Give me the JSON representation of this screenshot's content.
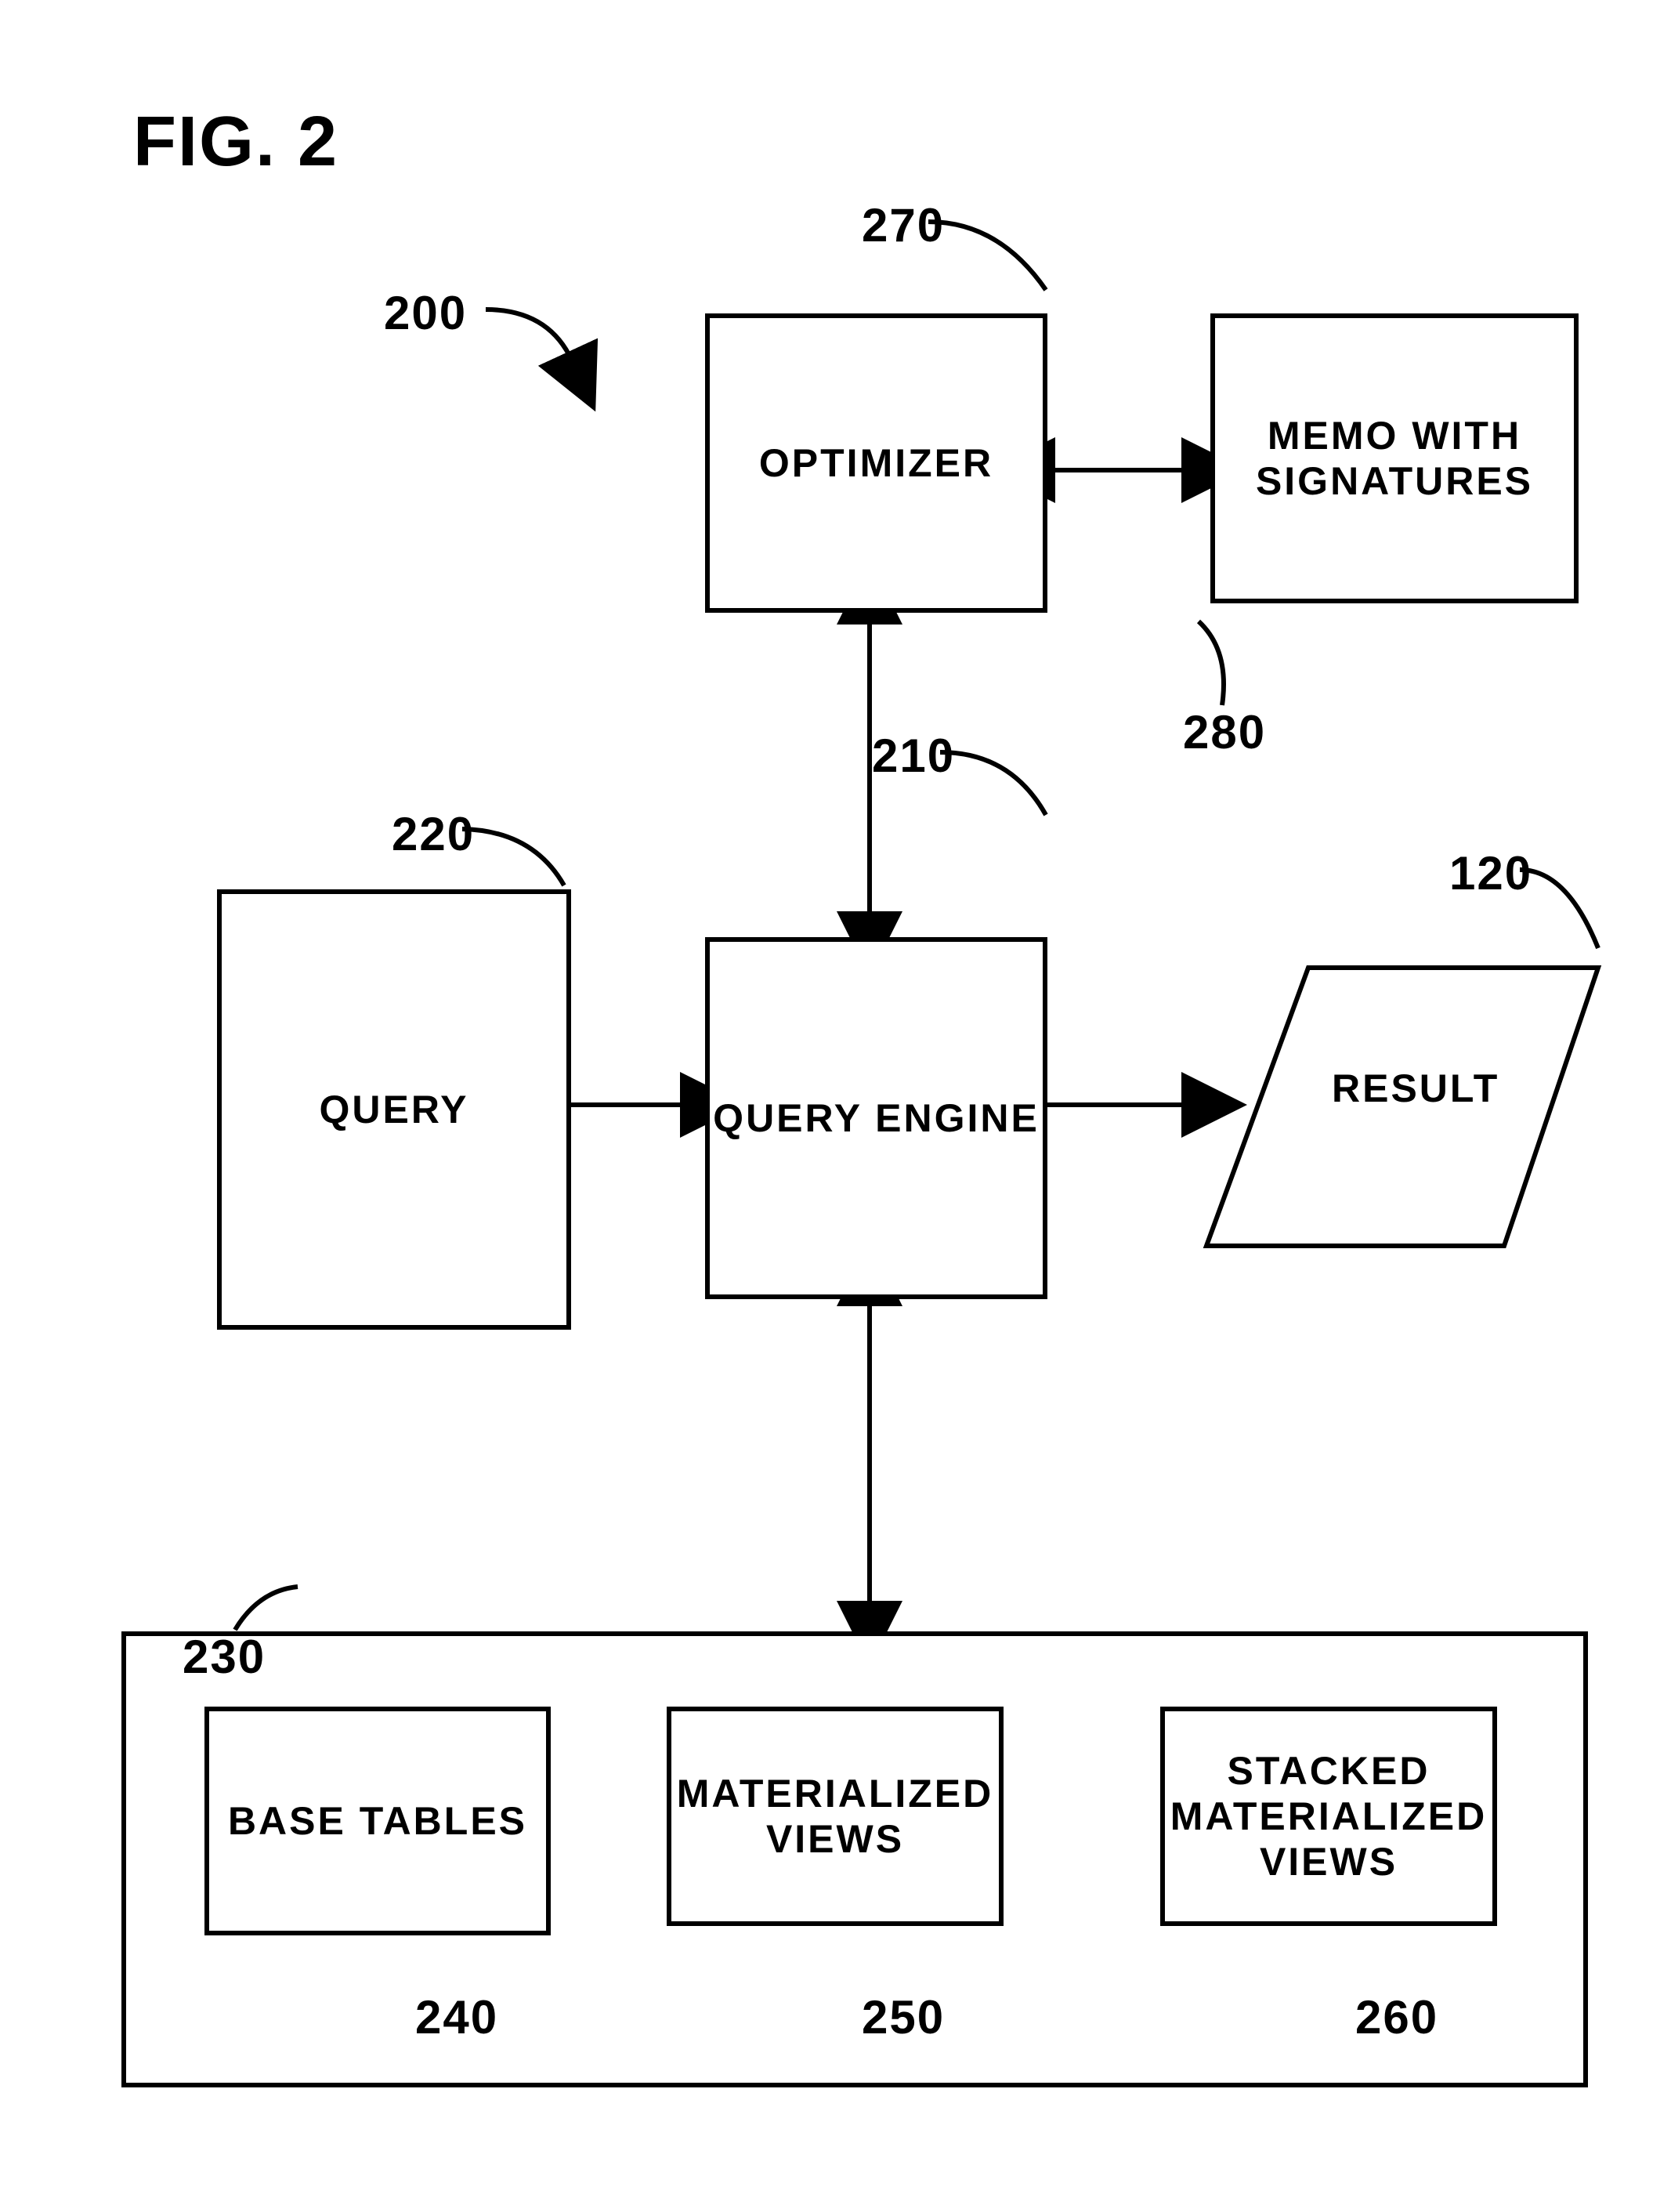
{
  "figure_title": "FIG. 2",
  "ref_200": "200",
  "blocks": {
    "query": {
      "label": "QUERY",
      "ref": "220"
    },
    "query_engine": {
      "label": "QUERY ENGINE",
      "ref": "210"
    },
    "optimizer": {
      "label": "OPTIMIZER",
      "ref": "270"
    },
    "memo": {
      "label": "MEMO WITH SIGNATURES",
      "ref": "280"
    },
    "result": {
      "label": "RESULT",
      "ref": "120"
    },
    "data_box": {
      "ref": "230"
    },
    "base_tables": {
      "label": "BASE TABLES",
      "ref": "240"
    },
    "mat_views": {
      "label": "MATERIALIZED VIEWS",
      "ref": "250"
    },
    "stacked_views": {
      "label": "STACKED MATERIALIZED VIEWS",
      "ref": "260"
    }
  }
}
